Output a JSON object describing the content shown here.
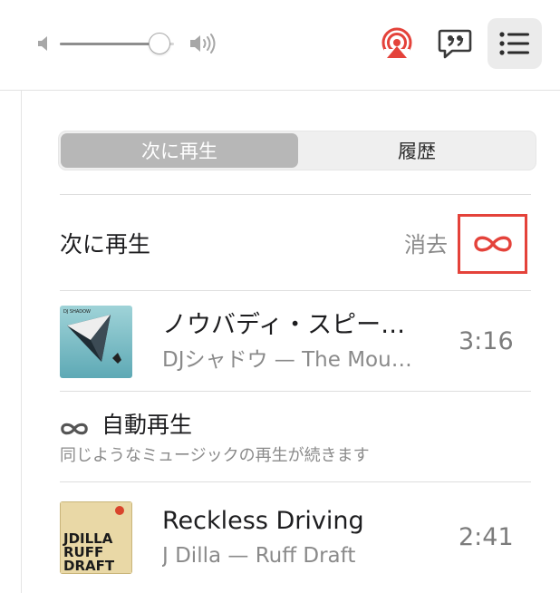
{
  "toolbar": {
    "volume_level": 0.87,
    "volume_low_icon": "speaker-low-icon",
    "volume_high_icon": "speaker-high-icon",
    "airplay_icon": "airplay-icon",
    "airplay_color": "#e4423a",
    "lyrics_icon": "lyrics-quote-icon",
    "queue_icon": "queue-list-icon"
  },
  "tabs": {
    "up_next": "次に再生",
    "history": "履歴",
    "selected": "up_next"
  },
  "up_next": {
    "title": "次に再生",
    "clear_label": "消去",
    "autoplay_icon": "infinity-icon",
    "autoplay_color": "#e4423a",
    "tracks": [
      {
        "title": "ノウバディ・スピー…",
        "subtitle": "DJシャドウ — The Mou…",
        "duration": "3:16",
        "art_text": "DJ SHADOW"
      }
    ]
  },
  "autoplay": {
    "title": "自動再生",
    "description": "同じようなミュージックの再生が続きます",
    "tracks": [
      {
        "title": "Reckless Driving",
        "subtitle": "J Dilla — Ruff Draft",
        "duration": "2:41",
        "art_lines": [
          "JDILLA",
          "RUFF",
          "DRAFT"
        ]
      }
    ]
  }
}
